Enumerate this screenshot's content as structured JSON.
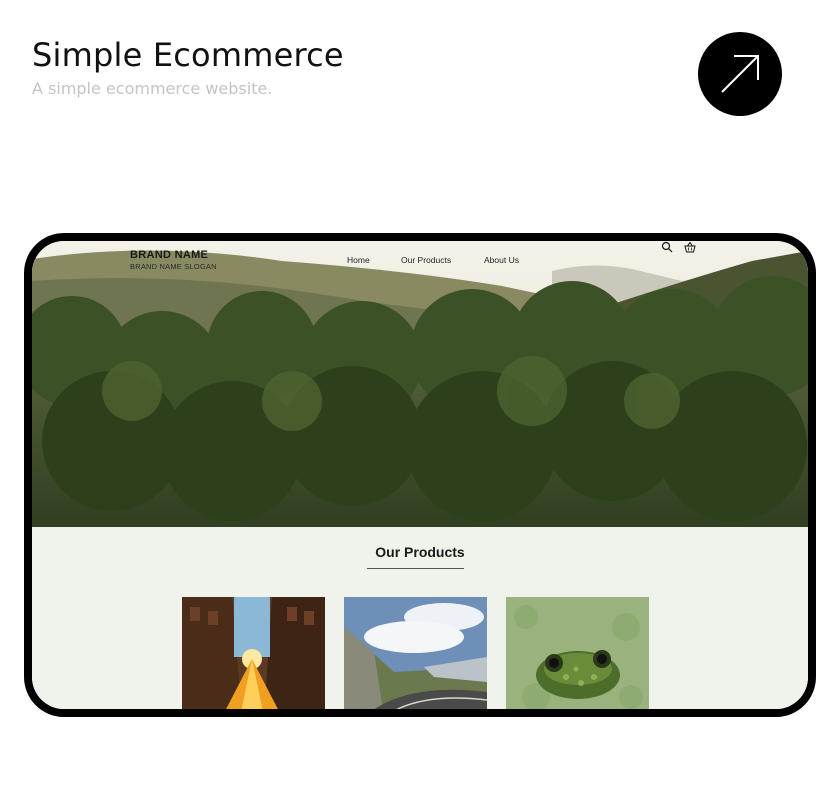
{
  "card": {
    "title": "Simple Ecommerce",
    "subtitle": "A simple ecommerce website.",
    "open_icon": "arrow-up-right-icon"
  },
  "site": {
    "brand_name": "BRAND NAME",
    "brand_slogan": "BRAND NAME SLOGAN",
    "nav_links": [
      "Home",
      "Our Products",
      "About Us"
    ],
    "nav_icons": [
      "search-icon",
      "basket-icon"
    ],
    "hero_image": "forest-mountains-image",
    "products_heading": "Our Products",
    "products": [
      {
        "image": "city-street-sunset-image"
      },
      {
        "image": "mountain-road-image"
      },
      {
        "image": "frog-in-algae-image"
      }
    ]
  },
  "colors": {
    "accent": "#000000",
    "subtitle": "#c4c4c4",
    "products_bg": "#eff3ec"
  }
}
